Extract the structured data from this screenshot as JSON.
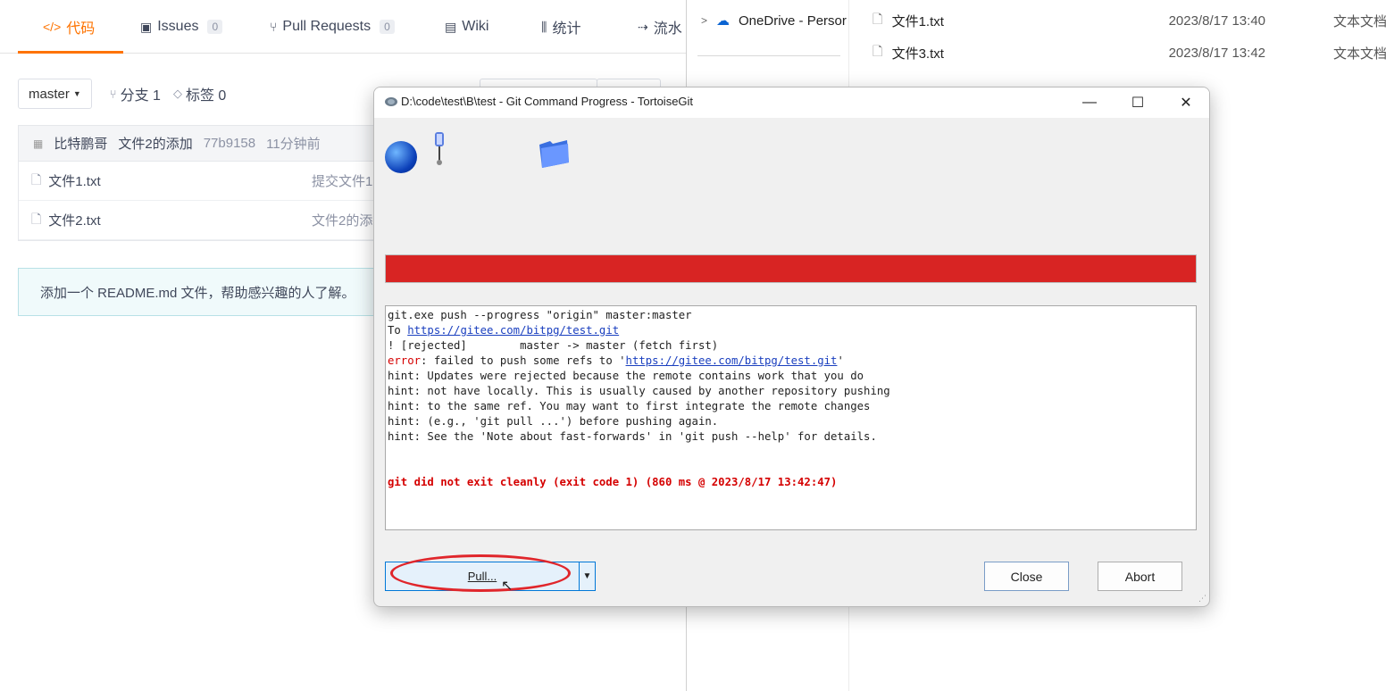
{
  "gitee": {
    "tabs": [
      {
        "icon": "</>",
        "label": "代码",
        "count": ""
      },
      {
        "icon": "▣",
        "label": "Issues",
        "count": "0"
      },
      {
        "icon": "⑂",
        "label": "Pull Requests",
        "count": "0"
      },
      {
        "icon": "▤",
        "label": "Wiki",
        "count": ""
      },
      {
        "icon": "⫼",
        "label": "统计",
        "count": ""
      },
      {
        "icon": "⇢",
        "label": "流水",
        "count": ""
      }
    ],
    "branch": "master",
    "branches_label": "分支 1",
    "tags_label": "标签 0",
    "commit": {
      "author": "比特鹏哥",
      "message": "文件2的添加",
      "hash": "77b9158",
      "time": "11分钟前"
    },
    "files": [
      {
        "name": "文件1.txt",
        "message": "提交文件1"
      },
      {
        "name": "文件2.txt",
        "message": "文件2的添"
      }
    ],
    "readme_hint": "添加一个 README.md 文件，帮助感兴趣的人了解。"
  },
  "explorer": {
    "nav_item": "OneDrive - Persor",
    "files": [
      {
        "name": "文件1.txt",
        "date": "2023/8/17 13:40",
        "type": "文本文档"
      },
      {
        "name": "文件3.txt",
        "date": "2023/8/17 13:42",
        "type": "文本文档"
      }
    ]
  },
  "dialog": {
    "title": "D:\\code\\test\\B\\test - Git Command Progress - TortoiseGit",
    "progress_color": "#d82423",
    "log": [
      {
        "text": "git.exe push --progress \"origin\" master:master",
        "style": "normal"
      },
      {
        "prefix": "To ",
        "link": "https://gitee.com/bitpg/test.git",
        "style": "link"
      },
      {
        "text": "! [rejected]        master -> master (fetch first)",
        "style": "normal"
      },
      {
        "prefix": "error",
        "middle": ": failed to push some refs to '",
        "link": "https://gitee.com/bitpg/test.git",
        "suffix": "'",
        "style": "error-link"
      },
      {
        "text": "hint: Updates were rejected because the remote contains work that you do",
        "style": "normal"
      },
      {
        "text": "hint: not have locally. This is usually caused by another repository pushing",
        "style": "normal"
      },
      {
        "text": "hint: to the same ref. You may want to first integrate the remote changes",
        "style": "normal"
      },
      {
        "text": "hint: (e.g., 'git pull ...') before pushing again.",
        "style": "normal"
      },
      {
        "text": "hint: See the 'Note about fast-forwards' in 'git push --help' for details.",
        "style": "normal"
      },
      {
        "text": "",
        "style": "normal"
      },
      {
        "text": "",
        "style": "normal"
      },
      {
        "text": "git did not exit cleanly (exit code 1) (860 ms @ 2023/8/17 13:42:47)",
        "style": "error-bold"
      }
    ],
    "buttons": {
      "pull": "Pull...",
      "close": "Close",
      "abort": "Abort"
    },
    "annotation_color": "#e0262b"
  }
}
